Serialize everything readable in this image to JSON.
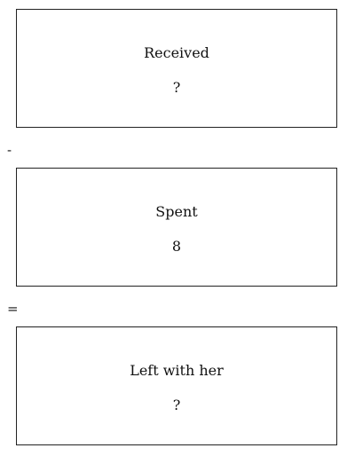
{
  "boxes": {
    "received": {
      "label": "Received",
      "value": "?"
    },
    "spent": {
      "label": "Spent",
      "value": "8"
    },
    "left": {
      "label": "Left with her",
      "value": "?"
    }
  },
  "operators": {
    "minus": "-",
    "equals": "="
  }
}
